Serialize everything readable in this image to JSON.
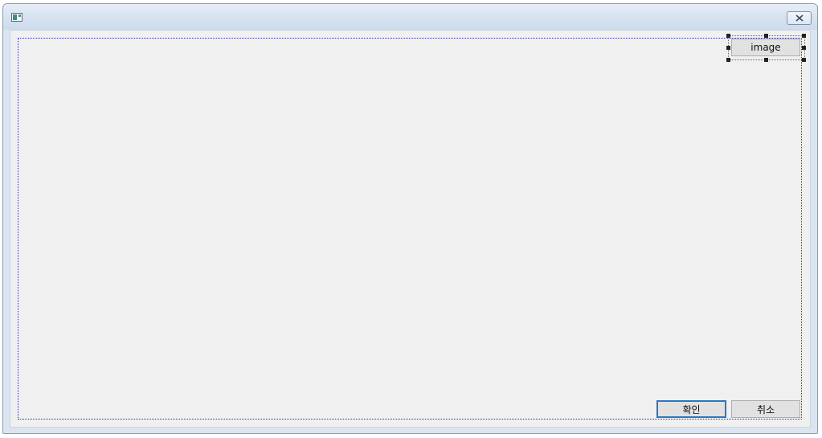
{
  "window": {
    "title": "",
    "icon": "app-window-icon",
    "close_icon": "close-x-icon"
  },
  "design_surface": {
    "buttons": {
      "image_label": "image",
      "ok_label": "확인",
      "cancel_label": "취소"
    }
  }
}
